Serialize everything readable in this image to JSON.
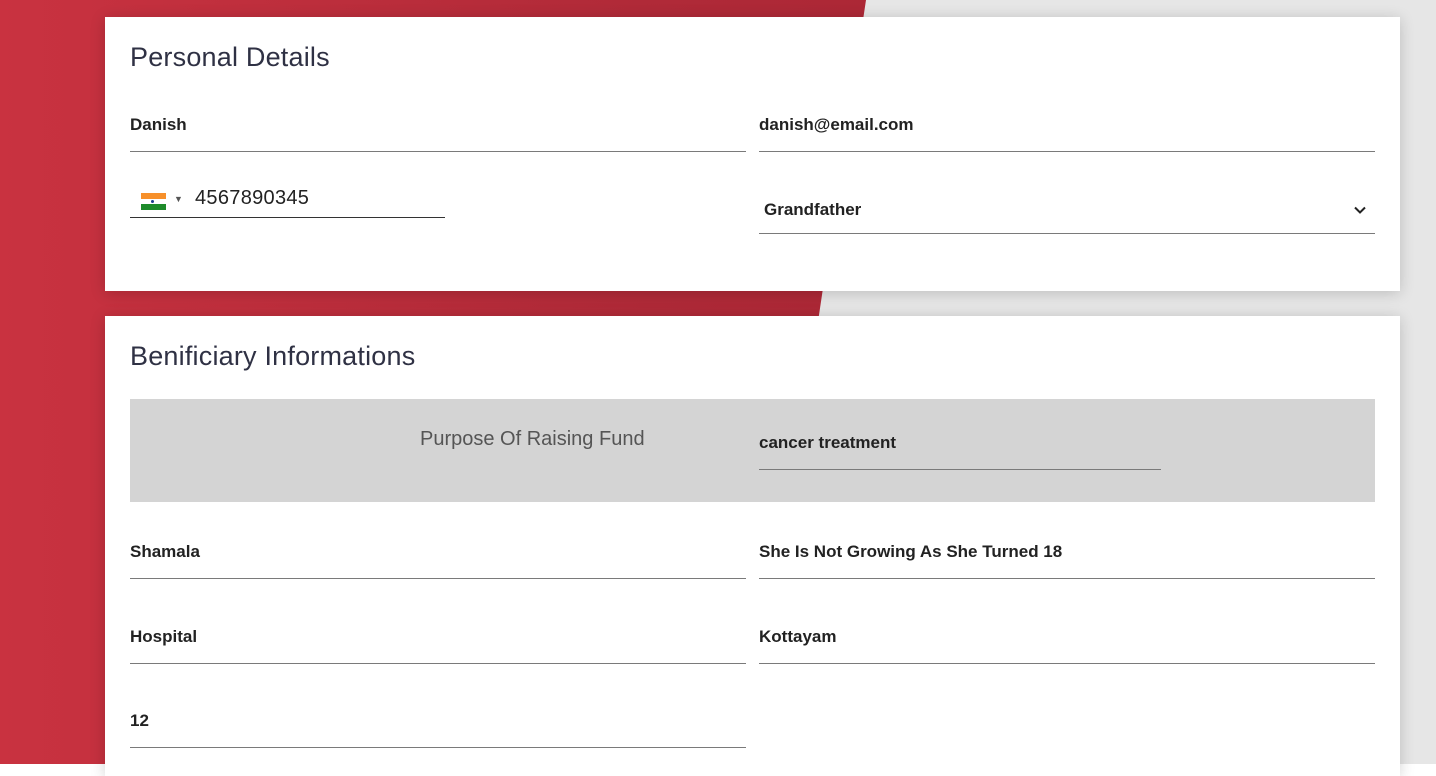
{
  "personal_details": {
    "title": "Personal Details",
    "name": "Danish",
    "email": "danish@email.com",
    "phone_country_flag": "india-flag-icon",
    "phone_number": "4567890345",
    "relation": "Grandfather"
  },
  "beneficiary": {
    "title": "Benificiary Informations",
    "purpose_label": "Purpose Of Raising Fund",
    "purpose_value": "cancer treatment",
    "name": "Shamala",
    "description": "She Is Not Growing As She Turned 18",
    "hospital": "Hospital",
    "city": "Kottayam",
    "age": "12"
  },
  "colors": {
    "accent_red": "#c93240",
    "purpose_bg": "#d4d4d4"
  }
}
